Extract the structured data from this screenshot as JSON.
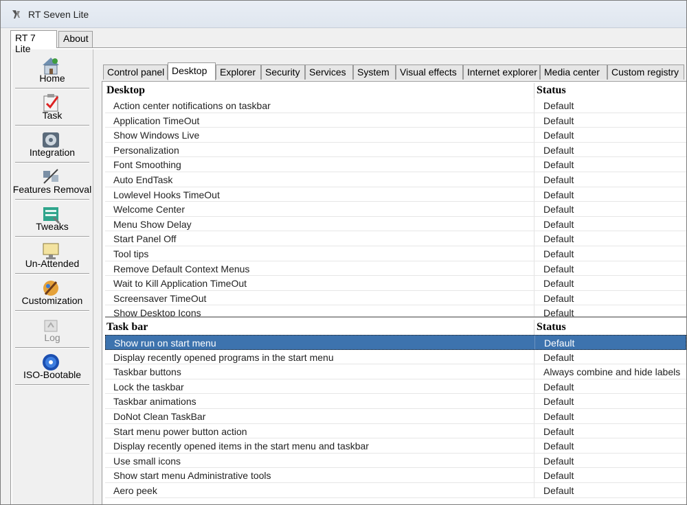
{
  "window": {
    "title": "RT Seven Lite"
  },
  "outer_tabs": [
    {
      "label": "RT 7 Lite",
      "active": true
    },
    {
      "label": "About",
      "active": false
    }
  ],
  "sidebar": {
    "items": [
      {
        "label": "Home",
        "icon": "home-icon"
      },
      {
        "label": "Task",
        "icon": "task-icon"
      },
      {
        "label": "Integration",
        "icon": "integration-icon"
      },
      {
        "label": "Features Removal",
        "icon": "features-removal-icon"
      },
      {
        "label": "Tweaks",
        "icon": "tweaks-icon"
      },
      {
        "label": "Un-Attended",
        "icon": "unattended-icon"
      },
      {
        "label": "Customization",
        "icon": "customization-icon"
      },
      {
        "label": "Log",
        "icon": "log-icon",
        "disabled": true
      },
      {
        "label": "ISO-Bootable",
        "icon": "iso-bootable-icon"
      }
    ]
  },
  "inner_tabs": [
    {
      "label": "Control panel",
      "active": false
    },
    {
      "label": "Desktop",
      "active": true
    },
    {
      "label": "Explorer",
      "active": false
    },
    {
      "label": "Security",
      "active": false
    },
    {
      "label": "Services",
      "active": false
    },
    {
      "label": "System",
      "active": false
    },
    {
      "label": "Visual effects",
      "active": false
    },
    {
      "label": "Internet explorer",
      "active": false
    },
    {
      "label": "Media center",
      "active": false
    },
    {
      "label": "Custom registry",
      "active": false
    }
  ],
  "desktop_grid": {
    "header_name": "Desktop",
    "header_status": "Status",
    "rows": [
      {
        "name": "Action center notifications on taskbar",
        "status": "Default"
      },
      {
        "name": "Application TimeOut",
        "status": "Default"
      },
      {
        "name": "Show Windows Live",
        "status": "Default"
      },
      {
        "name": "Personalization",
        "status": "Default"
      },
      {
        "name": "Font Smoothing",
        "status": "Default"
      },
      {
        "name": "Auto EndTask",
        "status": "Default"
      },
      {
        "name": "Lowlevel Hooks TimeOut",
        "status": "Default"
      },
      {
        "name": "Welcome Center",
        "status": "Default"
      },
      {
        "name": "Menu Show Delay",
        "status": "Default"
      },
      {
        "name": "Start Panel Off",
        "status": "Default"
      },
      {
        "name": "Tool tips",
        "status": "Default"
      },
      {
        "name": "Remove Default Context Menus",
        "status": "Default"
      },
      {
        "name": "Wait to Kill Application TimeOut",
        "status": "Default"
      },
      {
        "name": "Screensaver TimeOut",
        "status": "Default"
      },
      {
        "name": "Show Desktop Icons",
        "status": "Default"
      }
    ]
  },
  "taskbar_grid": {
    "header_name": "Task bar",
    "header_status": "Status",
    "rows": [
      {
        "name": "Show run on start menu",
        "status": "Default",
        "selected": true
      },
      {
        "name": "Display recently opened programs in the start menu",
        "status": "Default"
      },
      {
        "name": "Taskbar buttons",
        "status": "Always combine and hide labels"
      },
      {
        "name": "Lock the taskbar",
        "status": "Default"
      },
      {
        "name": "Taskbar animations",
        "status": "Default"
      },
      {
        "name": "DoNot Clean TaskBar",
        "status": "Default"
      },
      {
        "name": "Start menu power button action",
        "status": "Default"
      },
      {
        "name": "Display recently opened items in the start menu and taskbar",
        "status": "Default"
      },
      {
        "name": "Use small icons",
        "status": "Default"
      },
      {
        "name": "Show start menu Administrative tools",
        "status": "Default"
      },
      {
        "name": "Aero peek",
        "status": "Default"
      }
    ]
  },
  "colors": {
    "selection": "#3d73ae",
    "window_bg": "#f0f0f0"
  }
}
